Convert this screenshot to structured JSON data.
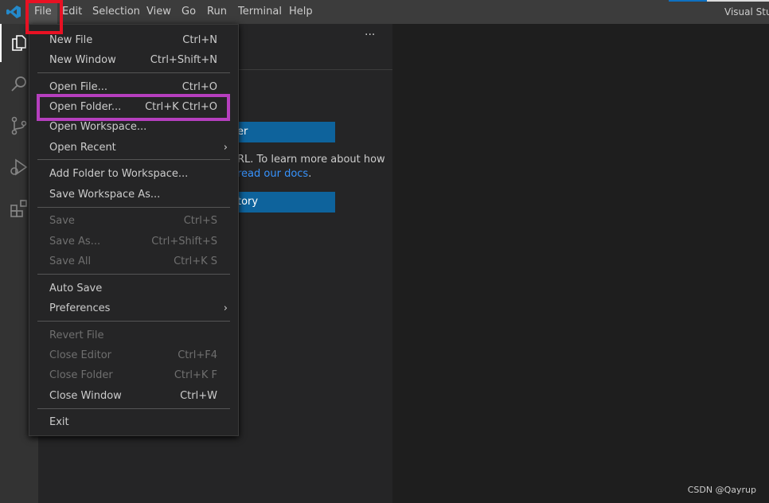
{
  "menubar": {
    "items": [
      "File",
      "Edit",
      "Selection",
      "View",
      "Go",
      "Run",
      "Terminal",
      "Help"
    ],
    "window_title": "Visual Studio"
  },
  "sidebar": {
    "more_label": "···",
    "button1": "er",
    "text1": "RL. To learn more about how",
    "link": "read our docs",
    "link_after": ".",
    "button2": "tory"
  },
  "file_menu": {
    "items": [
      {
        "label": "New File",
        "shortcut": "Ctrl+N"
      },
      {
        "label": "New Window",
        "shortcut": "Ctrl+Shift+N"
      },
      {
        "label": "Open File...",
        "shortcut": "Ctrl+O"
      },
      {
        "label": "Open Folder...",
        "shortcut": "Ctrl+K Ctrl+O"
      },
      {
        "label": "Open Workspace...",
        "shortcut": ""
      },
      {
        "label": "Open Recent",
        "shortcut": "",
        "submenu": true
      },
      {
        "label": "Add Folder to Workspace...",
        "shortcut": ""
      },
      {
        "label": "Save Workspace As...",
        "shortcut": ""
      },
      {
        "label": "Save",
        "shortcut": "Ctrl+S",
        "disabled": true
      },
      {
        "label": "Save As...",
        "shortcut": "Ctrl+Shift+S",
        "disabled": true
      },
      {
        "label": "Save All",
        "shortcut": "Ctrl+K S",
        "disabled": true
      },
      {
        "label": "Auto Save",
        "shortcut": ""
      },
      {
        "label": "Preferences",
        "shortcut": "",
        "submenu": true
      },
      {
        "label": "Revert File",
        "shortcut": "",
        "disabled": true
      },
      {
        "label": "Close Editor",
        "shortcut": "Ctrl+F4",
        "disabled": true
      },
      {
        "label": "Close Folder",
        "shortcut": "Ctrl+K F",
        "disabled": true
      },
      {
        "label": "Close Window",
        "shortcut": "Ctrl+W"
      },
      {
        "label": "Exit",
        "shortcut": ""
      }
    ],
    "submenu_arrow": "›"
  },
  "watermark": "CSDN @Qayrup",
  "colors": {
    "accent": "#0e639c",
    "link": "#3794ff",
    "highlight_file": "#e81123",
    "highlight_open_folder": "#b63fbe"
  }
}
